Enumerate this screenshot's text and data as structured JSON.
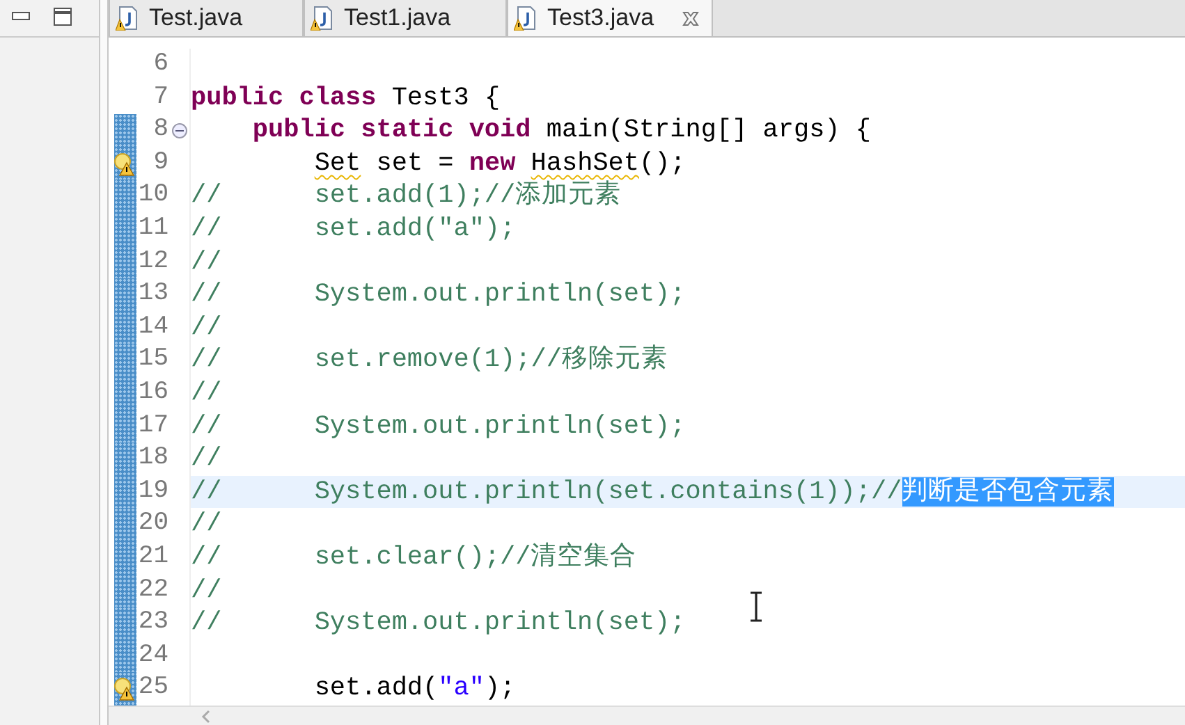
{
  "tabs": [
    {
      "label": "Test.java",
      "selected": false
    },
    {
      "label": "Test1.java",
      "selected": false
    },
    {
      "label": "Test3.java",
      "selected": true
    }
  ],
  "editor": {
    "lines": [
      {
        "number": "6",
        "changed": false,
        "current": false,
        "warning": false
      },
      {
        "number": "7",
        "changed": false,
        "current": false,
        "warning": false,
        "segments": [
          {
            "kind": "keyword",
            "text": "public class "
          },
          {
            "kind": "plain",
            "text": "Test3 {"
          }
        ]
      },
      {
        "number": "8",
        "changed": true,
        "current": false,
        "warning": false,
        "expanded": true,
        "segments": [
          {
            "kind": "keyword",
            "text": "    public static void "
          },
          {
            "kind": "plain",
            "text": "main(String[] args) {"
          }
        ]
      },
      {
        "number": "9",
        "changed": true,
        "current": false,
        "warning": true,
        "segments": [
          {
            "kind": "plain",
            "text": "        Set",
            "underlined": true
          },
          {
            "kind": "plain",
            "text": " set = "
          },
          {
            "kind": "keyword",
            "text": "new "
          },
          {
            "kind": "plain",
            "text": "HashSet",
            "underlined": true
          },
          {
            "kind": "plain",
            "text": "();"
          }
        ]
      },
      {
        "number": "10",
        "changed": true,
        "current": false,
        "warning": false,
        "segments": [
          {
            "kind": "comment",
            "text": "//      set.add(1);//添加元素"
          }
        ]
      },
      {
        "number": "11",
        "changed": true,
        "current": false,
        "warning": false,
        "segments": [
          {
            "kind": "comment",
            "text": "//      set.add(\"a\");"
          }
        ]
      },
      {
        "number": "12",
        "changed": true,
        "current": false,
        "warning": false,
        "segments": [
          {
            "kind": "comment",
            "text": "//"
          }
        ]
      },
      {
        "number": "13",
        "changed": true,
        "current": false,
        "warning": false,
        "segments": [
          {
            "kind": "comment",
            "text": "//      System.out.println(set);"
          }
        ]
      },
      {
        "number": "14",
        "changed": true,
        "current": false,
        "warning": false,
        "segments": [
          {
            "kind": "comment",
            "text": "//"
          }
        ]
      },
      {
        "number": "15",
        "changed": true,
        "current": false,
        "warning": false,
        "segments": [
          {
            "kind": "comment",
            "text": "//      set.remove(1);//移除元素"
          }
        ]
      },
      {
        "number": "16",
        "changed": true,
        "current": false,
        "warning": false,
        "segments": [
          {
            "kind": "comment",
            "text": "//"
          }
        ]
      },
      {
        "number": "17",
        "changed": true,
        "current": false,
        "warning": false,
        "segments": [
          {
            "kind": "comment",
            "text": "//      System.out.println(set);"
          }
        ]
      },
      {
        "number": "18",
        "changed": true,
        "current": false,
        "warning": false,
        "segments": [
          {
            "kind": "comment",
            "text": "//"
          }
        ]
      },
      {
        "number": "19",
        "changed": true,
        "current": true,
        "warning": false,
        "segments": [
          {
            "kind": "comment",
            "text": "//      System.out.println(set.contains(1));//"
          },
          {
            "kind": "comment",
            "text": "判断是否包含元素",
            "selected": true
          }
        ]
      },
      {
        "number": "20",
        "changed": true,
        "current": false,
        "warning": false,
        "segments": [
          {
            "kind": "comment",
            "text": "//"
          }
        ]
      },
      {
        "number": "21",
        "changed": true,
        "current": false,
        "warning": false,
        "segments": [
          {
            "kind": "comment",
            "text": "//      set.clear();//清空集合"
          }
        ]
      },
      {
        "number": "22",
        "changed": true,
        "current": false,
        "warning": false,
        "segments": [
          {
            "kind": "comment",
            "text": "//"
          }
        ]
      },
      {
        "number": "23",
        "changed": true,
        "current": false,
        "warning": false,
        "segments": [
          {
            "kind": "comment",
            "text": "//      System.out.println(set);"
          }
        ]
      },
      {
        "number": "24",
        "changed": true,
        "current": false,
        "warning": false
      },
      {
        "number": "25",
        "changed": true,
        "current": false,
        "warning": true,
        "segments": [
          {
            "kind": "plain",
            "text": "        set.add("
          },
          {
            "kind": "string",
            "text": "\"a\""
          },
          {
            "kind": "plain",
            "text": ");"
          }
        ]
      }
    ]
  }
}
